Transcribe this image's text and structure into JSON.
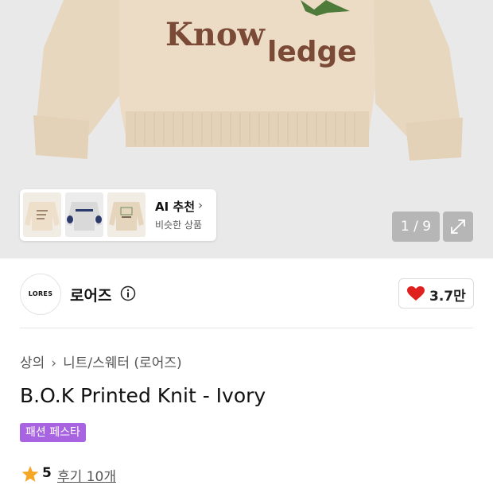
{
  "gallery": {
    "sweater_text_1": "Know",
    "sweater_text_2": "ledge",
    "ai_recommend": {
      "title": "AI 추천",
      "subtitle": "비슷한 상품"
    },
    "thumbnails": [
      "thumb-ivory-text",
      "thumb-grey-patch",
      "thumb-beige-print"
    ],
    "counter": "1 / 9",
    "expand_icon": "expand-icon"
  },
  "brand": {
    "logo_text": "LORES",
    "name": "로어즈",
    "like_count": "3.7만"
  },
  "breadcrumb": [
    "상의",
    "니트/스웨터 (로어즈)"
  ],
  "product": {
    "title": "B.O.K Printed Knit - Ivory",
    "badge": "패션 페스타",
    "rating": "5",
    "reviews": "후기 10개"
  },
  "colors": {
    "sweater": "#ecdcc6",
    "print_brown": "#7a4a36",
    "badge_purple": "#a864e0",
    "heart_red": "#e0201f",
    "star_orange": "#f5a623"
  }
}
